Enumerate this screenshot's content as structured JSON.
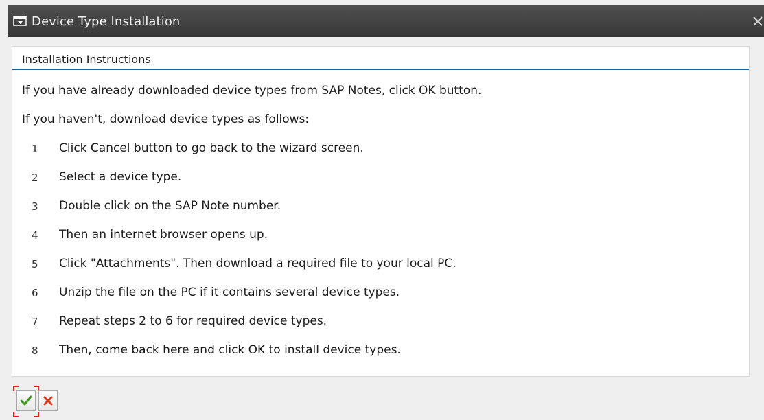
{
  "window": {
    "title": "Device Type Installation",
    "title_icon": "window-menu-icon",
    "close_icon": "close-icon"
  },
  "section": {
    "title": "Installation Instructions",
    "accent_color": "#0a6ab0"
  },
  "intro": [
    "If you have already downloaded device types from SAP Notes, click OK button.",
    "If you haven't, download device types as follows:"
  ],
  "steps": [
    {
      "num": "1",
      "text": "Click Cancel button to go back to the wizard screen."
    },
    {
      "num": "2",
      "text": "Select a device type."
    },
    {
      "num": "3",
      "text": "Double click on the SAP Note number."
    },
    {
      "num": "4",
      "text": "Then an internet browser opens up."
    },
    {
      "num": "5",
      "text": "Click \"Attachments\". Then download a required file to your local PC."
    },
    {
      "num": "6",
      "text": "Unzip the file on the PC if it contains several device types."
    },
    {
      "num": "7",
      "text": "Repeat steps 2 to 6 for required device types."
    },
    {
      "num": "8",
      "text": "Then, come back here and click OK to install device types."
    }
  ],
  "buttons": {
    "ok_icon": "checkmark-icon",
    "cancel_icon": "cross-icon",
    "ok_color": "#3c9a1e",
    "cancel_color": "#d43a1a",
    "focus_color": "#e0201a"
  }
}
